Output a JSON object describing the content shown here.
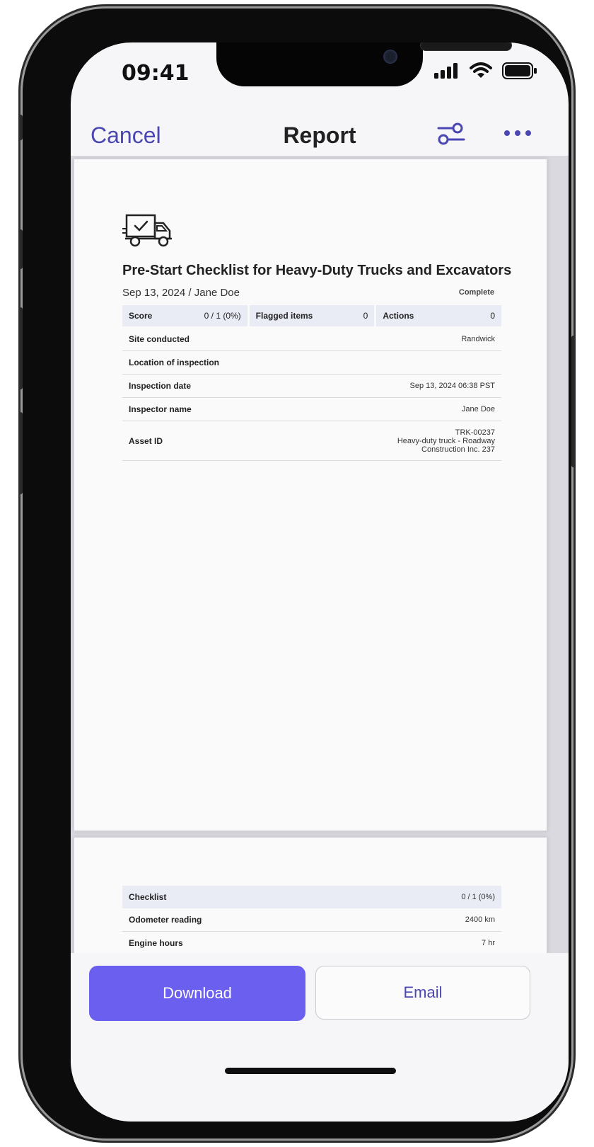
{
  "status_bar": {
    "time": "09:41"
  },
  "navbar": {
    "cancel_label": "Cancel",
    "title": "Report"
  },
  "report": {
    "title": "Pre-Start Checklist for Heavy-Duty Trucks and Excavators",
    "subtitle": "Sep 13, 2024 / Jane Doe",
    "status": "Complete",
    "summary": [
      {
        "label": "Score",
        "value": "0 / 1 (0%)"
      },
      {
        "label": "Flagged items",
        "value": "0"
      },
      {
        "label": "Actions",
        "value": "0"
      }
    ],
    "details": [
      {
        "label": "Site conducted",
        "value": "Randwick"
      },
      {
        "label": "Location of inspection",
        "value": ""
      },
      {
        "label": "Inspection date",
        "value": "Sep 13, 2024 06:38 PST"
      },
      {
        "label": "Inspector name",
        "value": "Jane Doe"
      },
      {
        "label": "Asset ID",
        "value_lines": [
          "TRK-00237",
          "Heavy-duty truck - Roadway",
          "Construction Inc. 237"
        ]
      }
    ],
    "checklist": {
      "label": "Checklist",
      "value": "0 / 1 (0%)",
      "rows": [
        {
          "label": "Odometer reading",
          "value": "2400 km"
        },
        {
          "label": "Engine hours",
          "value": "7 hr"
        }
      ]
    }
  },
  "actions": {
    "download_label": "Download",
    "email_label": "Email"
  },
  "colors": {
    "accent": "#6a5fef",
    "link": "#4a47b3",
    "table_header": "#e9ebf5"
  },
  "icons": [
    "cellular-signal-icon",
    "wifi-icon",
    "battery-icon",
    "filter-sliders-icon",
    "more-icon",
    "truck-check-icon"
  ]
}
